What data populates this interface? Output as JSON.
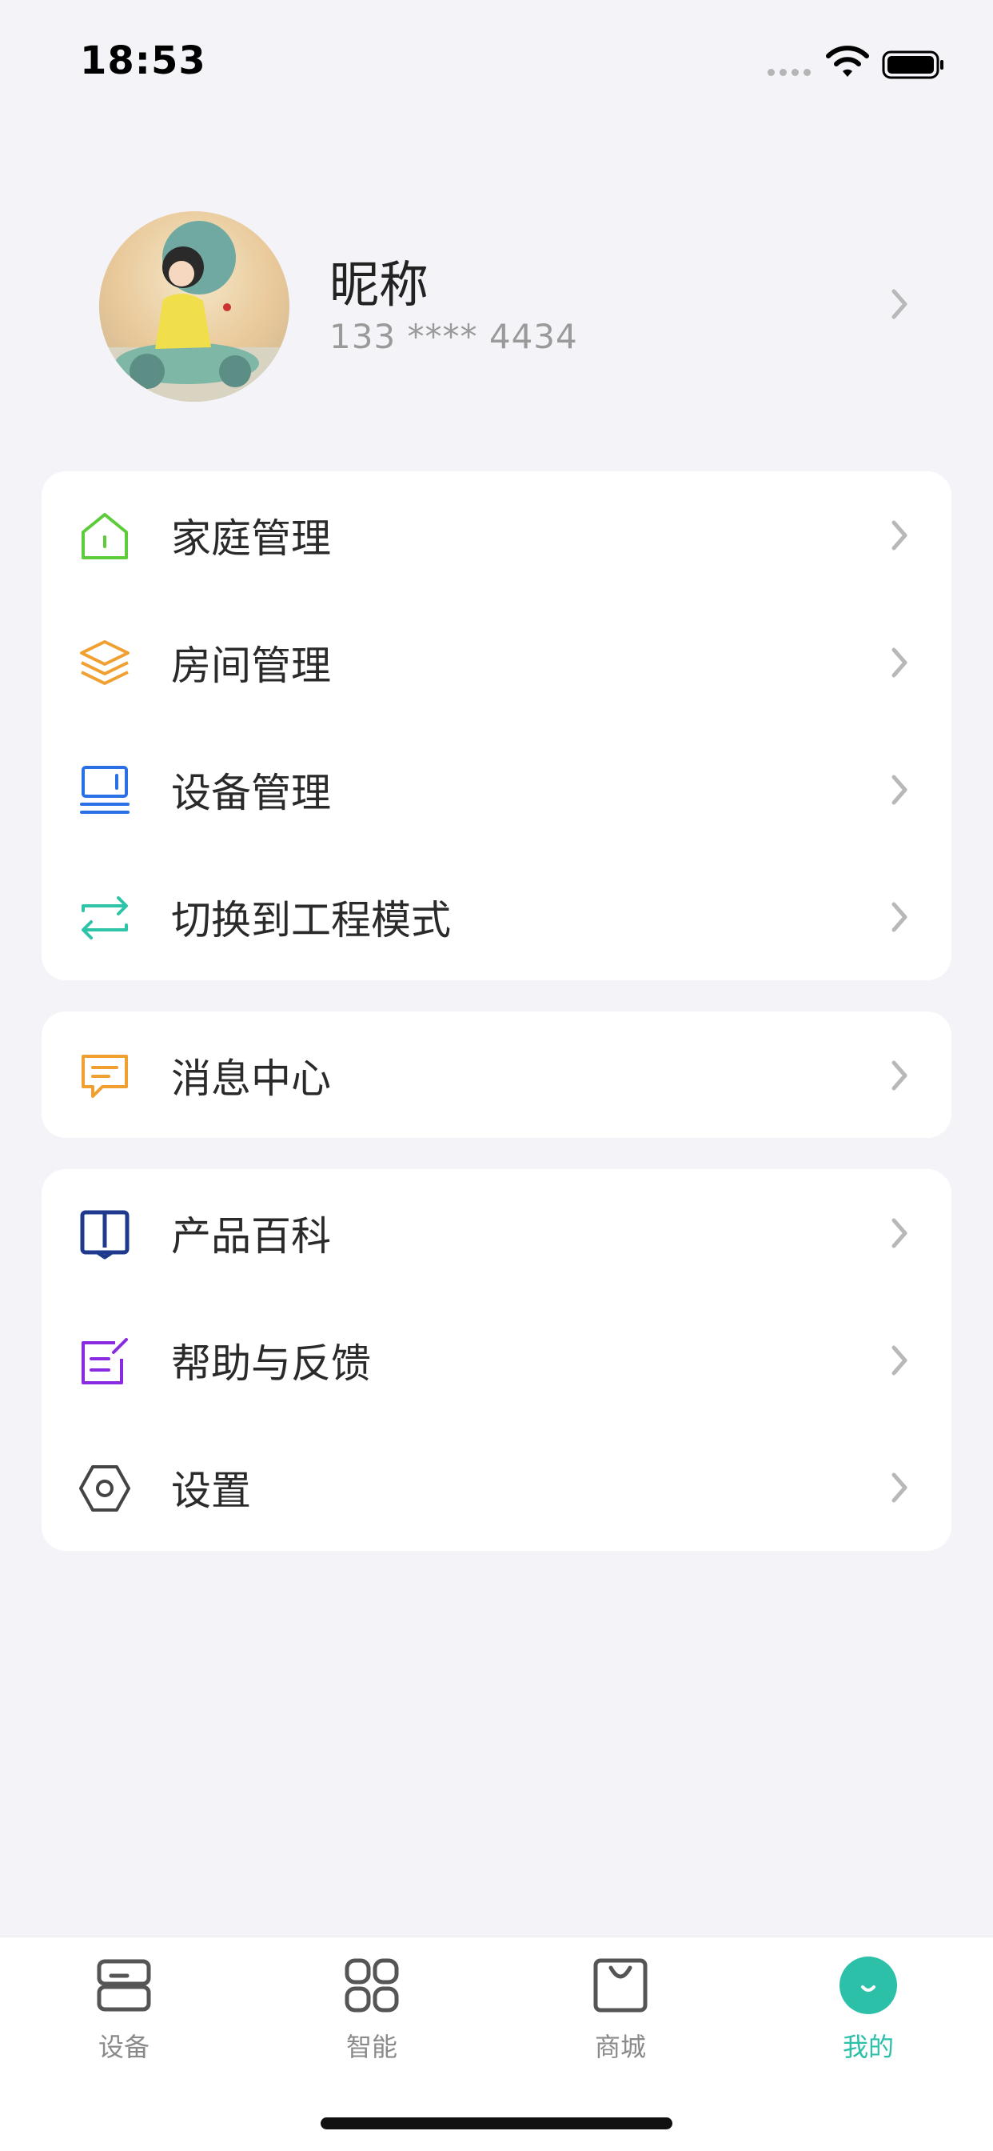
{
  "status_bar": {
    "time": "18:53"
  },
  "profile": {
    "nickname": "昵称",
    "phone": "133 **** 4434"
  },
  "menu_group_1": [
    {
      "label": "家庭管理",
      "icon": "home-icon",
      "color": "#5dcc3a"
    },
    {
      "label": "房间管理",
      "icon": "layers-icon",
      "color": "#f0a030"
    },
    {
      "label": "设备管理",
      "icon": "monitor-icon",
      "color": "#2a6fe6"
    },
    {
      "label": "切换到工程模式",
      "icon": "switch-icon",
      "color": "#2ec4a8"
    }
  ],
  "menu_group_2": [
    {
      "label": "消息中心",
      "icon": "message-icon",
      "color": "#f0a030"
    }
  ],
  "menu_group_3": [
    {
      "label": "产品百科",
      "icon": "book-icon",
      "color": "#1f3a8c"
    },
    {
      "label": "帮助与反馈",
      "icon": "feedback-icon",
      "color": "#8a2be2"
    },
    {
      "label": "设置",
      "icon": "settings-icon",
      "color": "#444444"
    }
  ],
  "tab_bar": {
    "tabs": [
      {
        "label": "设备",
        "icon": "device-icon"
      },
      {
        "label": "智能",
        "icon": "smart-grid-icon"
      },
      {
        "label": "商城",
        "icon": "shop-bag-icon"
      },
      {
        "label": "我的",
        "icon": "mine-icon"
      }
    ],
    "active_index": 3,
    "active_color": "#2cc0a8"
  }
}
